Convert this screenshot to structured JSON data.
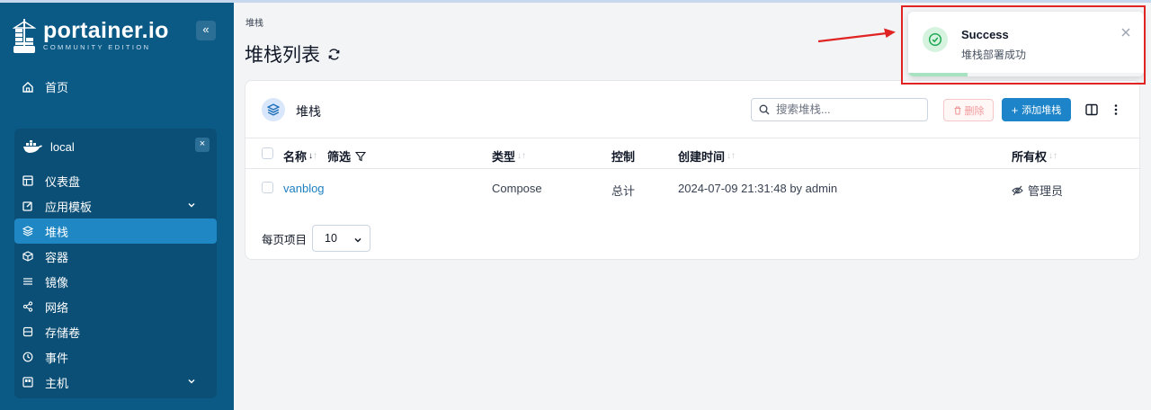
{
  "brand": {
    "name": "portainer.io",
    "edition": "COMMUNITY EDITION",
    "collapse_glyph": "«"
  },
  "sidebar": {
    "home_label": "首页",
    "environment": {
      "name": "local",
      "close_glyph": "×"
    },
    "items": [
      {
        "label": "仪表盘",
        "icon": "dashboard-icon"
      },
      {
        "label": "应用模板",
        "icon": "edit-icon",
        "expandable": true
      },
      {
        "label": "堆栈",
        "icon": "layers-icon",
        "active": true
      },
      {
        "label": "容器",
        "icon": "box-icon"
      },
      {
        "label": "镜像",
        "icon": "list-icon"
      },
      {
        "label": "网络",
        "icon": "share-icon"
      },
      {
        "label": "存储卷",
        "icon": "database-icon"
      },
      {
        "label": "事件",
        "icon": "clock-icon"
      },
      {
        "label": "主机",
        "icon": "server-icon",
        "expandable": true
      }
    ]
  },
  "header": {
    "breadcrumb": "堆栈",
    "title": "堆栈列表"
  },
  "card": {
    "title": "堆栈",
    "search_placeholder": "搜索堆栈...",
    "delete_label": "删除",
    "add_label": "添加堆栈",
    "add_glyph": "+"
  },
  "table": {
    "columns": {
      "name": "名称",
      "filter": "筛选",
      "type": "类型",
      "control": "控制",
      "created": "创建时间",
      "ownership": "所有权"
    },
    "sort_up": "↑",
    "sort_down": "↓",
    "rows": [
      {
        "name": "vanblog",
        "type": "Compose",
        "control": "总计",
        "created": "2024-07-09 21:31:48 by admin",
        "ownership": "管理员"
      }
    ]
  },
  "pagination": {
    "label": "每页项目",
    "value": "10"
  },
  "toast": {
    "title": "Success",
    "message": "堆栈部署成功",
    "progress": 0.25
  },
  "colors": {
    "sidebar": "#0b5a86",
    "active": "#1f87c4",
    "primary": "#1d84c9",
    "annotation": "#e02424"
  }
}
